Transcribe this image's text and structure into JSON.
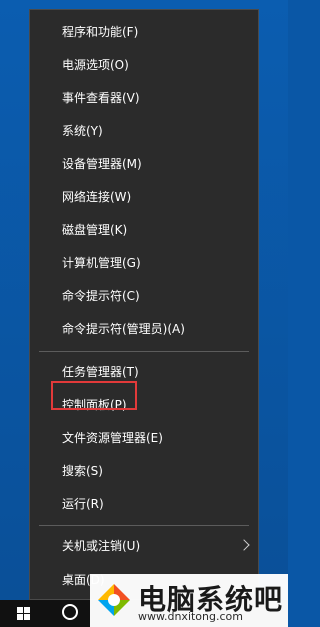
{
  "menu": {
    "items": [
      {
        "label": "程序和功能(F)"
      },
      {
        "label": "电源选项(O)"
      },
      {
        "label": "事件查看器(V)"
      },
      {
        "label": "系统(Y)"
      },
      {
        "label": "设备管理器(M)"
      },
      {
        "label": "网络连接(W)"
      },
      {
        "label": "磁盘管理(K)"
      },
      {
        "label": "计算机管理(G)"
      },
      {
        "label": "命令提示符(C)"
      },
      {
        "label": "命令提示符(管理员)(A)"
      },
      {
        "label": "任务管理器(T)"
      },
      {
        "label": "控制面板(P)"
      },
      {
        "label": "文件资源管理器(E)"
      },
      {
        "label": "搜索(S)"
      },
      {
        "label": "运行(R)"
      },
      {
        "label": "关机或注销(U)"
      },
      {
        "label": "桌面(D)"
      }
    ]
  },
  "watermark": {
    "title": "电脑系统吧",
    "url": "www.dnxitong.com"
  },
  "colors": {
    "menu_bg": "#2b2b2b",
    "highlight": "#e23a3a",
    "desktop": "#0a57a6"
  }
}
